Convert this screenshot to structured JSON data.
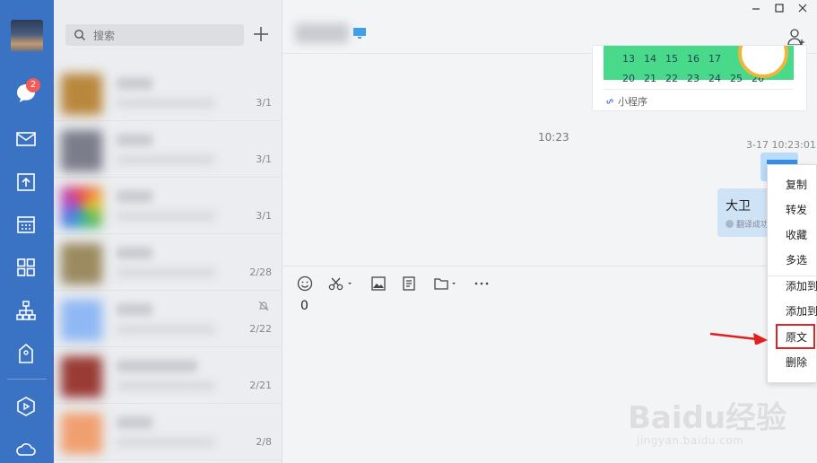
{
  "rail": {
    "unread_count": "2",
    "icons": [
      "chat-icon",
      "mail-icon",
      "docs-icon",
      "calendar-icon",
      "apps-icon",
      "org-chart-icon",
      "location-icon",
      "workspace-icon",
      "cloud-icon"
    ],
    "accent": "#3a72c4"
  },
  "search": {
    "placeholder": "搜索"
  },
  "conversations": [
    {
      "date": "3/1",
      "thumb": "#b9873c"
    },
    {
      "date": "3/1",
      "thumb": "#7b7d8a"
    },
    {
      "date": "3/1",
      "thumb": "#d050a0"
    },
    {
      "date": "2/28",
      "thumb": "#9b8a60"
    },
    {
      "date": "2/22",
      "thumb": "#8fb8f4"
    },
    {
      "date": "2/21",
      "thumb": "#9a3b35"
    },
    {
      "date": "2/8",
      "thumb": "#f0a070"
    }
  ],
  "card": {
    "calendar_row1": [
      "13",
      "14",
      "15",
      "16",
      "17"
    ],
    "calendar_row2": [
      "20",
      "21",
      "22",
      "23",
      "24",
      "25",
      "26"
    ],
    "label": "小程序"
  },
  "messages": {
    "time_center": "10:23",
    "time_right": "3-17 10:23:01",
    "translated_text": "大卫",
    "translated_note": "翻译成功"
  },
  "input": {
    "text": "0"
  },
  "menu": {
    "items": [
      "复制",
      "转发",
      "收藏",
      "多选",
      "添加到",
      "添加到",
      "原文",
      "删除"
    ],
    "highlight_color": "#d8262b"
  },
  "watermark": {
    "brand": "Baidu经验",
    "url": "jingyan.baidu.com"
  }
}
